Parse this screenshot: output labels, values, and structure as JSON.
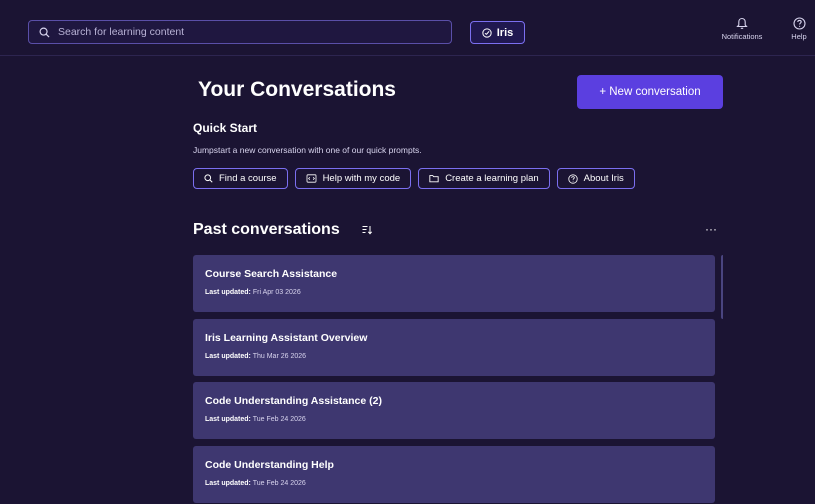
{
  "topbar": {
    "search_placeholder": "Search for learning content",
    "iris_label": "Iris",
    "notifications_label": "Notifications",
    "help_label": "Help"
  },
  "main": {
    "title": "Your Conversations",
    "new_conversation_label": "+ New conversation",
    "quick_start": {
      "title": "Quick Start",
      "subtitle": "Jumpstart a new conversation with one of our quick prompts.",
      "prompts": [
        {
          "label": "Find a course",
          "icon": "search-icon"
        },
        {
          "label": "Help with my code",
          "icon": "code-icon"
        },
        {
          "label": "Create a learning plan",
          "icon": "folder-icon"
        },
        {
          "label": "About Iris",
          "icon": "question-icon"
        }
      ]
    },
    "past": {
      "title": "Past conversations",
      "more_label": "···",
      "meta_label": "Last updated:",
      "items": [
        {
          "title": "Course Search Assistance",
          "date": "Fri Apr 03 2026"
        },
        {
          "title": "Iris Learning Assistant Overview",
          "date": "Thu Mar 26 2026"
        },
        {
          "title": "Code Understanding Assistance (2)",
          "date": "Tue Feb 24 2026"
        },
        {
          "title": "Code Understanding Help",
          "date": "Tue Feb 24 2026"
        }
      ]
    }
  },
  "colors": {
    "background": "#1b1433",
    "accent": "#5b3fe0",
    "card": "#3e3770",
    "outline": "#7b6ff0"
  }
}
